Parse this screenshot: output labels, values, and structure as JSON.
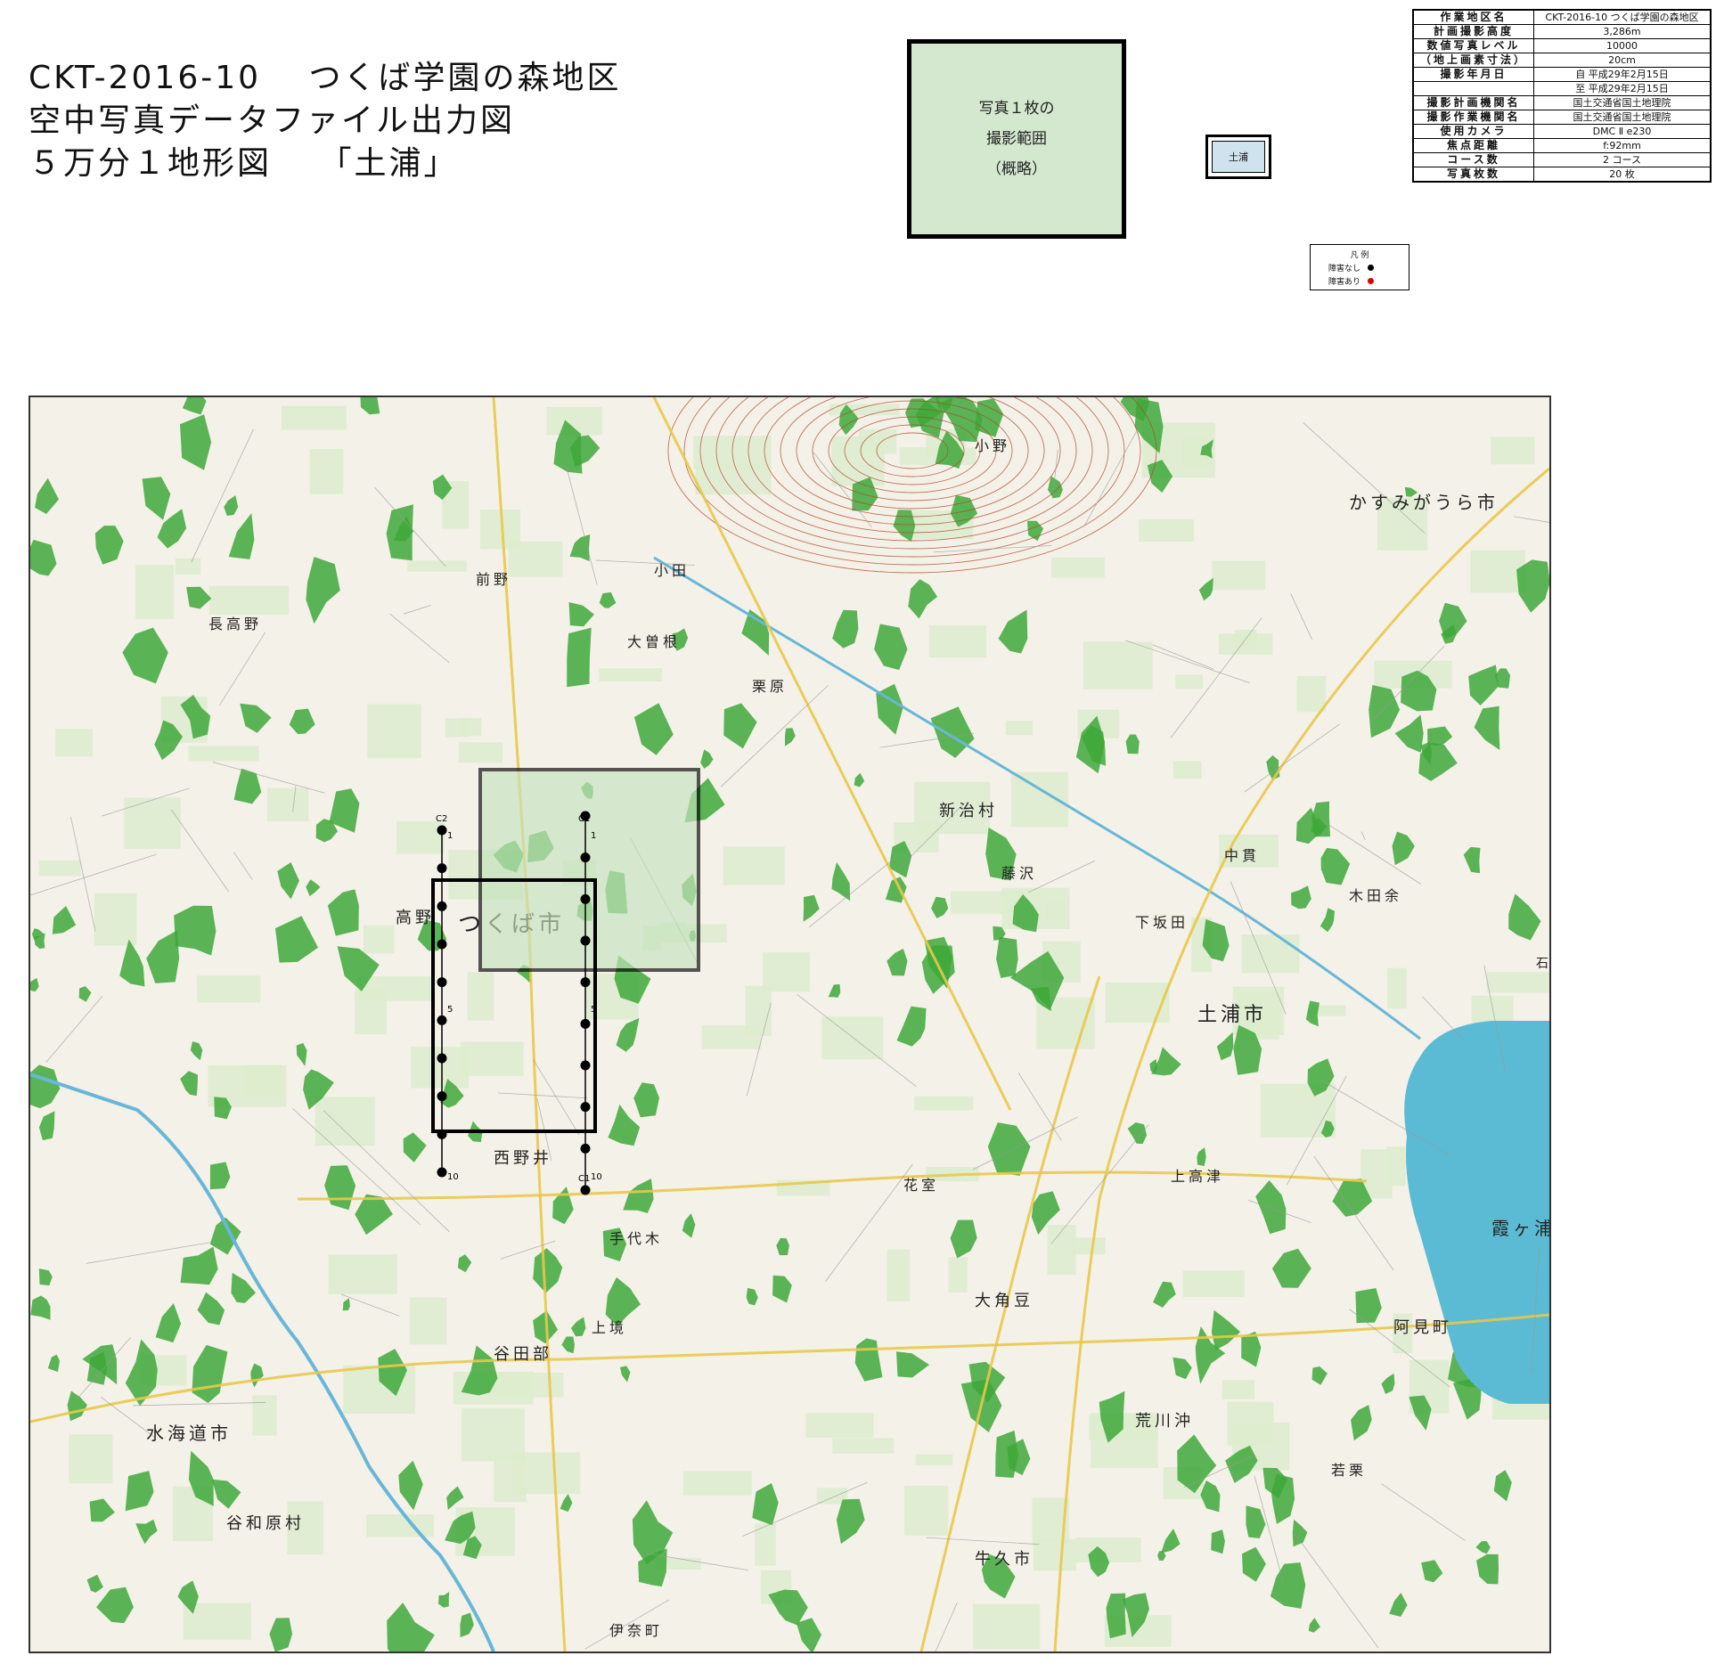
{
  "title": {
    "line1": "CKT-2016-10　 つくば学園の森地区",
    "line2": "空中写真データファイル出力図",
    "line3": "５万分１地形図　 「土浦」"
  },
  "photo_legend": {
    "line1": "写真１枚の",
    "line2": "撮影範囲",
    "line3": "（概略）"
  },
  "index_box": {
    "label": "土浦"
  },
  "info_table": [
    {
      "label": "作業地区名",
      "value": "CKT-2016-10 つくば学園の森地区"
    },
    {
      "label": "計画撮影高度",
      "value": "3,286m"
    },
    {
      "label": "数値写真レベル",
      "value": "10000"
    },
    {
      "label": "（地上画素寸法）",
      "value": "20cm"
    },
    {
      "label": "撮影年月日",
      "value": "自 平成29年2月15日"
    },
    {
      "label": "",
      "value": "至 平成29年2月15日"
    },
    {
      "label": "撮影計画機関名",
      "value": "国土交通省国土地理院"
    },
    {
      "label": "撮影作業機関名",
      "value": "国土交通省国土地理院"
    },
    {
      "label": "使用カメラ",
      "value": "DMC Ⅱ e230"
    },
    {
      "label": "焦点距離",
      "value": "f:92mm"
    },
    {
      "label": "コース数",
      "value": "2 コース"
    },
    {
      "label": "写真枚数",
      "value": "20 枚"
    }
  ],
  "legend": {
    "title": "凡 例",
    "items": [
      {
        "label": "障害なし",
        "color": "#000000"
      },
      {
        "label": "障害あり",
        "color": "#e00000"
      }
    ]
  },
  "map": {
    "colors": {
      "base": "#f4f1e8",
      "forest": "#3ea83a",
      "field": "#dceccd",
      "water": "#5bbbd4",
      "river": "#67b7d8",
      "road_major": "#e8c84a",
      "contour": "#b04a2a",
      "coverage": "#c6e3be",
      "flight_line": "#000000"
    },
    "place_labels": [
      "かすみがうら市",
      "つくば市",
      "土浦市",
      "霞ヶ浦",
      "水海道市",
      "谷田部",
      "西野井",
      "高野",
      "大角豆",
      "阿見町",
      "荒川沖",
      "牛久市",
      "新治村",
      "藤沢",
      "下坂田",
      "小野",
      "木田余",
      "手代木",
      "花室",
      "大曽根",
      "栗原",
      "小田",
      "伊奈町",
      "谷和原村",
      "中貫",
      "上境",
      "石田",
      "前野",
      "長高野",
      "若栗",
      "上高津"
    ],
    "course_labels": [
      "C1",
      "C2",
      "C1",
      "1",
      "5",
      "10",
      "1",
      "5",
      "10"
    ]
  }
}
